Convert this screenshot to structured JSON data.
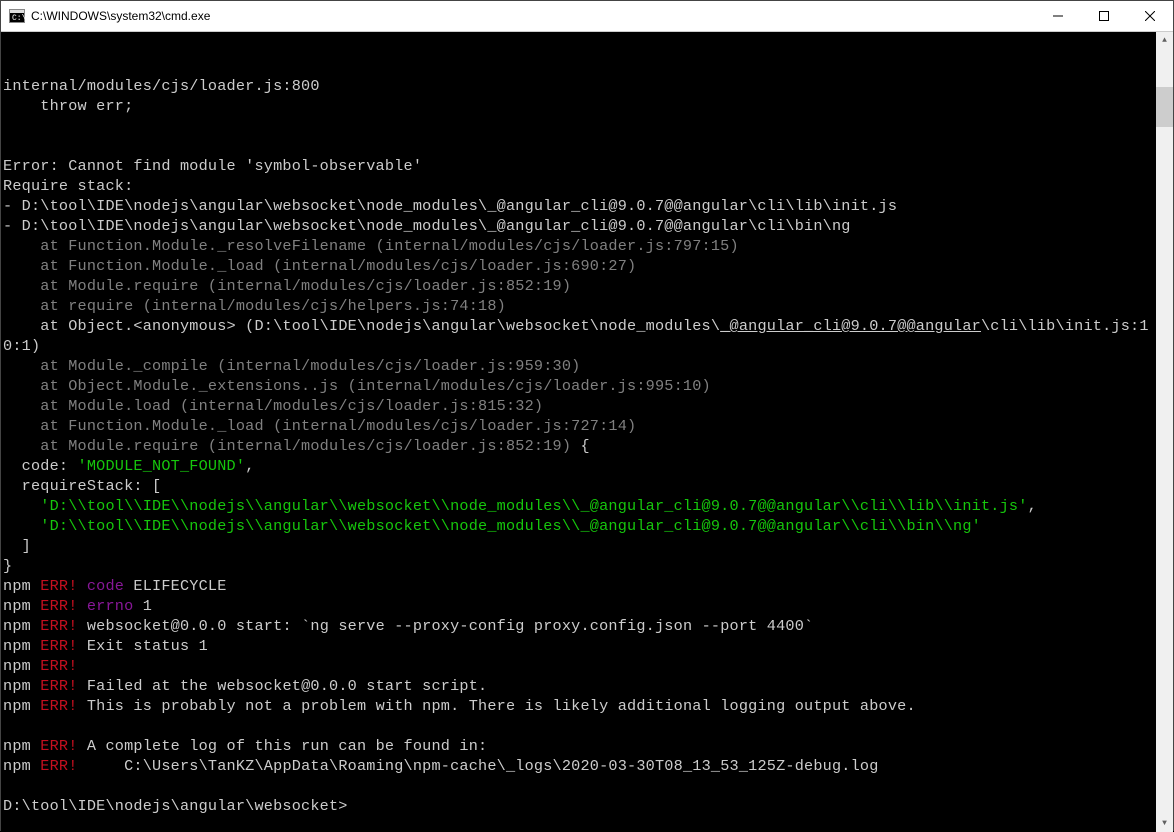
{
  "window": {
    "title": "C:\\WINDOWS\\system32\\cmd.exe"
  },
  "lines": {
    "l0": "",
    "l1": "internal/modules/cjs/loader.js:800",
    "l2": "    throw err;",
    "l3": "",
    "l4": "",
    "l5": "Error: Cannot find module 'symbol-observable'",
    "l6": "Require stack:",
    "l7": "- D:\\tool\\IDE\\nodejs\\angular\\websocket\\node_modules\\_@angular_cli@9.0.7@@angular\\cli\\lib\\init.js",
    "l8": "- D:\\tool\\IDE\\nodejs\\angular\\websocket\\node_modules\\_@angular_cli@9.0.7@@angular\\cli\\bin\\ng",
    "l9": "    at Function.Module._resolveFilename (internal/modules/cjs/loader.js:797:15)",
    "l10": "    at Function.Module._load (internal/modules/cjs/loader.js:690:27)",
    "l11": "    at Module.require (internal/modules/cjs/loader.js:852:19)",
    "l12": "    at require (internal/modules/cjs/helpers.js:74:18)",
    "l13a": "    at Object.<anonymous> (D:\\tool\\IDE\\nodejs\\angular\\websocket\\node_modules\\",
    "l13b": "_@angular_cli@9.0.7@@angular",
    "l13c": "\\cli\\lib\\init.js:10:1)",
    "l14": "    at Module._compile (internal/modules/cjs/loader.js:959:30)",
    "l15": "    at Object.Module._extensions..js (internal/modules/cjs/loader.js:995:10)",
    "l16": "    at Module.load (internal/modules/cjs/loader.js:815:32)",
    "l17": "    at Function.Module._load (internal/modules/cjs/loader.js:727:14)",
    "l18a": "    at Module.require (internal/modules/cjs/loader.js:852:19)",
    "l18b": " {",
    "l19a": "  code: ",
    "l19b": "'MODULE_NOT_FOUND'",
    "l19c": ",",
    "l20": "  requireStack: [",
    "l21a": "    ",
    "l21b": "'D:\\\\tool\\\\IDE\\\\nodejs\\\\angular\\\\websocket\\\\node_modules\\\\_@angular_cli@9.0.7@@angular\\\\cli\\\\lib\\\\init.js'",
    "l21c": ",",
    "l22a": "    ",
    "l22b": "'D:\\\\tool\\\\IDE\\\\nodejs\\\\angular\\\\websocket\\\\node_modules\\\\_@angular_cli@9.0.7@@angular\\\\cli\\\\bin\\\\ng'",
    "l23": "  ]",
    "l24": "}",
    "npm": "npm",
    "err": " ERR!",
    "n1a": " code ",
    "n1b": "ELIFECYCLE",
    "n2a": " errno",
    "n2b": " 1",
    "n3": " websocket@0.0.0 start: `ng serve --proxy-config proxy.config.json --port 4400`",
    "n4": " Exit status 1",
    "n5": "",
    "n6": " Failed at the websocket@0.0.0 start script.",
    "n7": " This is probably not a problem with npm. There is likely additional logging output above.",
    "n8": " A complete log of this run can be found in:",
    "n9": "     C:\\Users\\TanKZ\\AppData\\Roaming\\npm-cache\\_logs\\2020-03-30T08_13_53_125Z-debug.log",
    "prompt": "D:\\tool\\IDE\\nodejs\\angular\\websocket>"
  }
}
